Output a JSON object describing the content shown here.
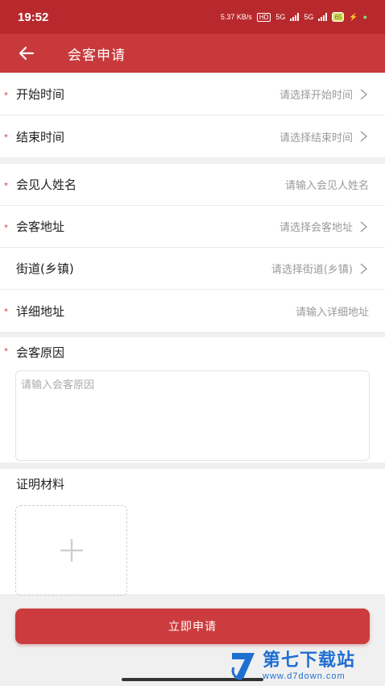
{
  "status_bar": {
    "time": "19:52",
    "net_speed": "5.37 KB/s",
    "hd_badge": "HD",
    "sim1": "5G",
    "sim2": "5G",
    "battery": "65"
  },
  "nav": {
    "title": "会客申请",
    "back_icon": "arrow-left-icon"
  },
  "form": {
    "time_section": [
      {
        "label": "开始时间",
        "value": "请选择开始时间",
        "required": true,
        "chevron": true
      },
      {
        "label": "结束时间",
        "value": "请选择结束时间",
        "required": true,
        "chevron": true
      }
    ],
    "info_section": [
      {
        "label": "会见人姓名",
        "value": "请输入会见人姓名",
        "required": true,
        "chevron": false
      },
      {
        "label": "会客地址",
        "value": "请选择会客地址",
        "required": true,
        "chevron": true
      },
      {
        "label": "街道(乡镇)",
        "value": "请选择街道(乡镇)",
        "required": false,
        "chevron": true
      },
      {
        "label": "详细地址",
        "value": "请输入详细地址",
        "required": true,
        "chevron": false
      }
    ],
    "reason": {
      "label": "会客原因",
      "placeholder": "请输入会客原因",
      "required": true
    },
    "attachment": {
      "label": "证明材料",
      "add_icon": "plus-icon"
    }
  },
  "submit_label": "立即申请",
  "watermark": {
    "name": "第七下载站",
    "url": "www.d7down.com"
  },
  "colors": {
    "status_bar": "#b8292d",
    "nav_bar": "#c8393b",
    "button": "#cc3c3e",
    "required_star": "#d23a3a",
    "watermark": "#1f6fd1"
  }
}
